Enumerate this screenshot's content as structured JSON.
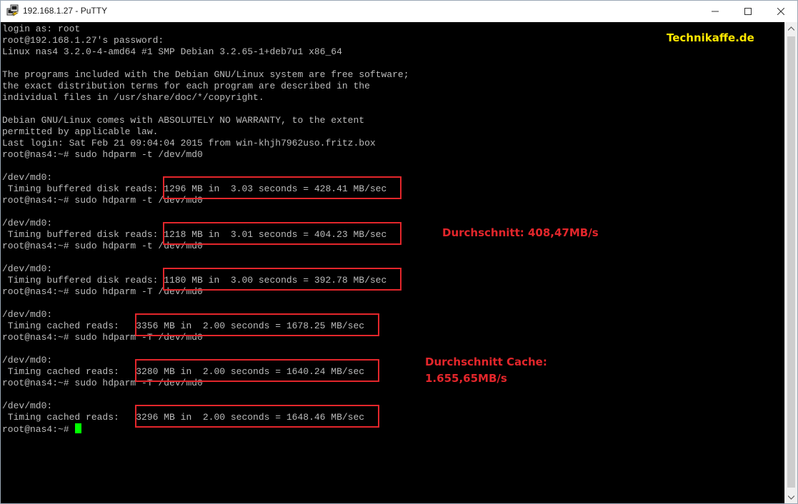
{
  "window": {
    "title": "192.168.1.27 - PuTTY",
    "app_icon": "putty-terminal-icon",
    "controls": {
      "minimize_icon": "minimize-icon",
      "maximize_icon": "maximize-icon",
      "close_icon": "close-icon"
    }
  },
  "terminal": {
    "lines": [
      "login as: root",
      "root@192.168.1.27's password:",
      "Linux nas4 3.2.0-4-amd64 #1 SMP Debian 3.2.65-1+deb7u1 x86_64",
      "",
      "The programs included with the Debian GNU/Linux system are free software;",
      "the exact distribution terms for each program are described in the",
      "individual files in /usr/share/doc/*/copyright.",
      "",
      "Debian GNU/Linux comes with ABSOLUTELY NO WARRANTY, to the extent",
      "permitted by applicable law.",
      "Last login: Sat Feb 21 09:04:04 2015 from win-khjh7962uso.fritz.box",
      "root@nas4:~# sudo hdparm -t /dev/md0",
      "",
      "/dev/md0:",
      " Timing buffered disk reads: 1296 MB in  3.03 seconds = 428.41 MB/sec",
      "root@nas4:~# sudo hdparm -t /dev/md0",
      "",
      "/dev/md0:",
      " Timing buffered disk reads: 1218 MB in  3.01 seconds = 404.23 MB/sec",
      "root@nas4:~# sudo hdparm -t /dev/md0",
      "",
      "/dev/md0:",
      " Timing buffered disk reads: 1180 MB in  3.00 seconds = 392.78 MB/sec",
      "root@nas4:~# sudo hdparm -T /dev/md0",
      "",
      "/dev/md0:",
      " Timing cached reads:   3356 MB in  2.00 seconds = 1678.25 MB/sec",
      "root@nas4:~# sudo hdparm -T /dev/md0",
      "",
      "/dev/md0:",
      " Timing cached reads:   3280 MB in  2.00 seconds = 1640.24 MB/sec",
      "root@nas4:~# sudo hdparm -T /dev/md0",
      "",
      "/dev/md0:",
      " Timing cached reads:   3296 MB in  2.00 seconds = 1648.46 MB/sec",
      "root@nas4:~# "
    ],
    "cursor_color": "#00ff00",
    "text_color": "#bbbbbb",
    "background": "#000000"
  },
  "overlay": {
    "brand": "Technikaffe.de",
    "annotation_disk": "Durchschnitt: 408,47MB/s",
    "annotation_cache_line1": "Durchschnitt Cache:",
    "annotation_cache_line2": "1.655,65MB/s",
    "highlight_color": "#e3262b",
    "brand_color": "#ffe800"
  },
  "scrollbar": {
    "up_icon": "scroll-up-arrow-icon",
    "down_icon": "scroll-down-arrow-icon"
  }
}
